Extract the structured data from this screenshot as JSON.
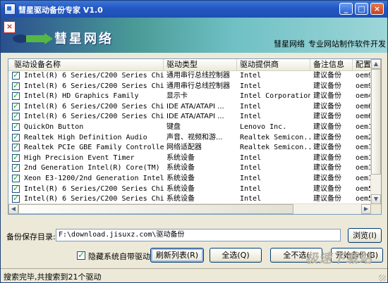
{
  "window": {
    "title": "彗星驱动备份专家 V1.0"
  },
  "title_buttons": {
    "minimize": "_",
    "maximize": "□",
    "close": "×"
  },
  "banner": {
    "close_mark": "×",
    "brand": "彗星网络",
    "links": [
      "彗星网络",
      "专业网站制作",
      "软件开发"
    ]
  },
  "table": {
    "columns": [
      "驱动设备名称",
      "驱动类型",
      "驱动提供商",
      "备注信息",
      "配置"
    ],
    "rows": [
      {
        "checked": true,
        "name": "Intel(R) 6 Series/C200 Series Chip...",
        "type": "通用串行总线控制器",
        "provider": "Intel",
        "note": "建议备份",
        "config": "oem9."
      },
      {
        "checked": true,
        "name": "Intel(R) 6 Series/C200 Series Chip...",
        "type": "通用串行总线控制器",
        "provider": "Intel",
        "note": "建议备份",
        "config": "oem9."
      },
      {
        "checked": true,
        "name": "Intel(R) HD Graphics Family",
        "type": "显示卡",
        "provider": "Intel Corporation",
        "note": "建议备份",
        "config": "oem4."
      },
      {
        "checked": true,
        "name": "Intel(R) 6 Series/C200 Series Chip...",
        "type": "IDE ATA/ATAPI ...",
        "provider": "Intel",
        "note": "建议备份",
        "config": "oem6."
      },
      {
        "checked": true,
        "name": "Intel(R) 6 Series/C200 Series Chip...",
        "type": "IDE ATA/ATAPI ...",
        "provider": "Intel",
        "note": "建议备份",
        "config": "oem6."
      },
      {
        "checked": true,
        "name": "QuickOn Button",
        "type": "键盘",
        "provider": "Lenovo Inc.",
        "note": "建议备份",
        "config": "oem1."
      },
      {
        "checked": true,
        "name": "Realtek High Definition Audio",
        "type": "声音、视频和游...",
        "provider": "Realtek Semicon...",
        "note": "建议备份",
        "config": "oem2."
      },
      {
        "checked": true,
        "name": "Realtek PCIe GBE Family Controller",
        "type": "网络适配器",
        "provider": "Realtek Semicon...",
        "note": "建议备份",
        "config": "oem11"
      },
      {
        "checked": true,
        "name": "High Precision Event Timer",
        "type": "系统设备",
        "provider": "Intel",
        "note": "建议备份",
        "config": "oem10"
      },
      {
        "checked": true,
        "name": "2nd Generation Intel(R) Core(TM) P...",
        "type": "系统设备",
        "provider": "Intel",
        "note": "建议备份",
        "config": "oem10"
      },
      {
        "checked": true,
        "name": "Xeon E3-1200/2nd Generation Intel(...",
        "type": "系统设备",
        "provider": "Intel",
        "note": "建议备份",
        "config": "oem10"
      },
      {
        "checked": true,
        "name": "Intel(R) 6 Series/C200 Series Chip...",
        "type": "系统设备",
        "provider": "Intel",
        "note": "建议备份",
        "config": "oem5."
      },
      {
        "checked": true,
        "name": "Intel(R) 6 Series/C200 Series Chip...",
        "type": "系统设备",
        "provider": "Intel",
        "note": "建议备份",
        "config": "oem5."
      },
      {
        "checked": true,
        "name": "Intel(R) 6 Series/C200 Series Chip...",
        "type": "系统设备",
        "provider": "Intel",
        "note": "建议备份",
        "config": "oem5."
      }
    ]
  },
  "backup": {
    "label": "备份保存目录:",
    "path": "F:\\download.jisuxz.com\\驱动备份",
    "browse": "浏览(I)"
  },
  "controls": {
    "hide_system_label": "隐藏系统自带驱动",
    "hide_system_checked": true,
    "refresh": "刷新列表(R)",
    "select_all": "全选(Q)",
    "select_none": "全不选(",
    "backup": "开始备份(B)"
  },
  "status": {
    "text": "搜索完毕,共搜索到21个驱动"
  },
  "watermark": "极速下载站",
  "colors": {
    "title_bar": "#2357c2",
    "banner_start": "#2a4f8e",
    "banner_end": "#9dd6d8",
    "check_green": "#21a121"
  }
}
